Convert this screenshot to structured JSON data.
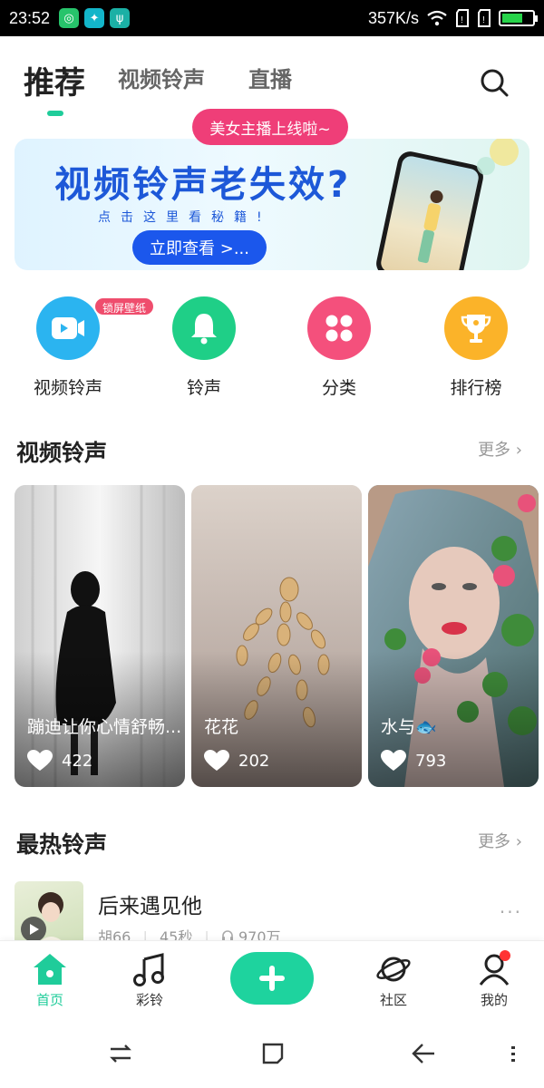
{
  "status_bar": {
    "time": "23:52",
    "speed": "357K/s",
    "battery_level": 0.7
  },
  "top_tabs": [
    {
      "label": "推荐",
      "active": true
    },
    {
      "label": "视频铃声",
      "active": false
    },
    {
      "label": "直播",
      "active": false
    }
  ],
  "live_bubble": "美女主播上线啦~",
  "banner": {
    "title": "视频铃声老失效?",
    "subtitle": "点击这里看秘籍!",
    "button": "立即查看 >..."
  },
  "quick_entries": [
    {
      "label": "视频铃声",
      "icon": "video-icon",
      "color": "#2bb4f0",
      "badge": "锁屏壁纸"
    },
    {
      "label": "铃声",
      "icon": "bell-icon",
      "color": "#1fcf87"
    },
    {
      "label": "分类",
      "icon": "category-icon",
      "color": "#f4507c"
    },
    {
      "label": "排行榜",
      "icon": "trophy-icon",
      "color": "#fbb329"
    }
  ],
  "video_section": {
    "title": "视频铃声",
    "more": "更多",
    "cards": [
      {
        "title": "蹦迪让你心情舒畅...",
        "likes": "422"
      },
      {
        "title": "花花",
        "likes": "202"
      },
      {
        "title": "水与🐟",
        "likes": "793"
      }
    ]
  },
  "hot_section": {
    "title": "最热铃声",
    "more": "更多",
    "songs": [
      {
        "title": "后来遇见他",
        "artist": "胡66",
        "duration": "45秒",
        "plays": "970万"
      }
    ]
  },
  "bottom_nav": [
    {
      "label": "首页",
      "icon": "home-icon",
      "active": true
    },
    {
      "label": "彩铃",
      "icon": "music-note-icon",
      "active": false
    },
    {
      "label": "社区",
      "icon": "planet-icon",
      "active": false
    },
    {
      "label": "我的",
      "icon": "profile-icon",
      "active": false
    }
  ],
  "colors": {
    "accent": "#1fcc9a",
    "bubble": "#ef3e78",
    "banner_blue": "#1d58d8"
  }
}
